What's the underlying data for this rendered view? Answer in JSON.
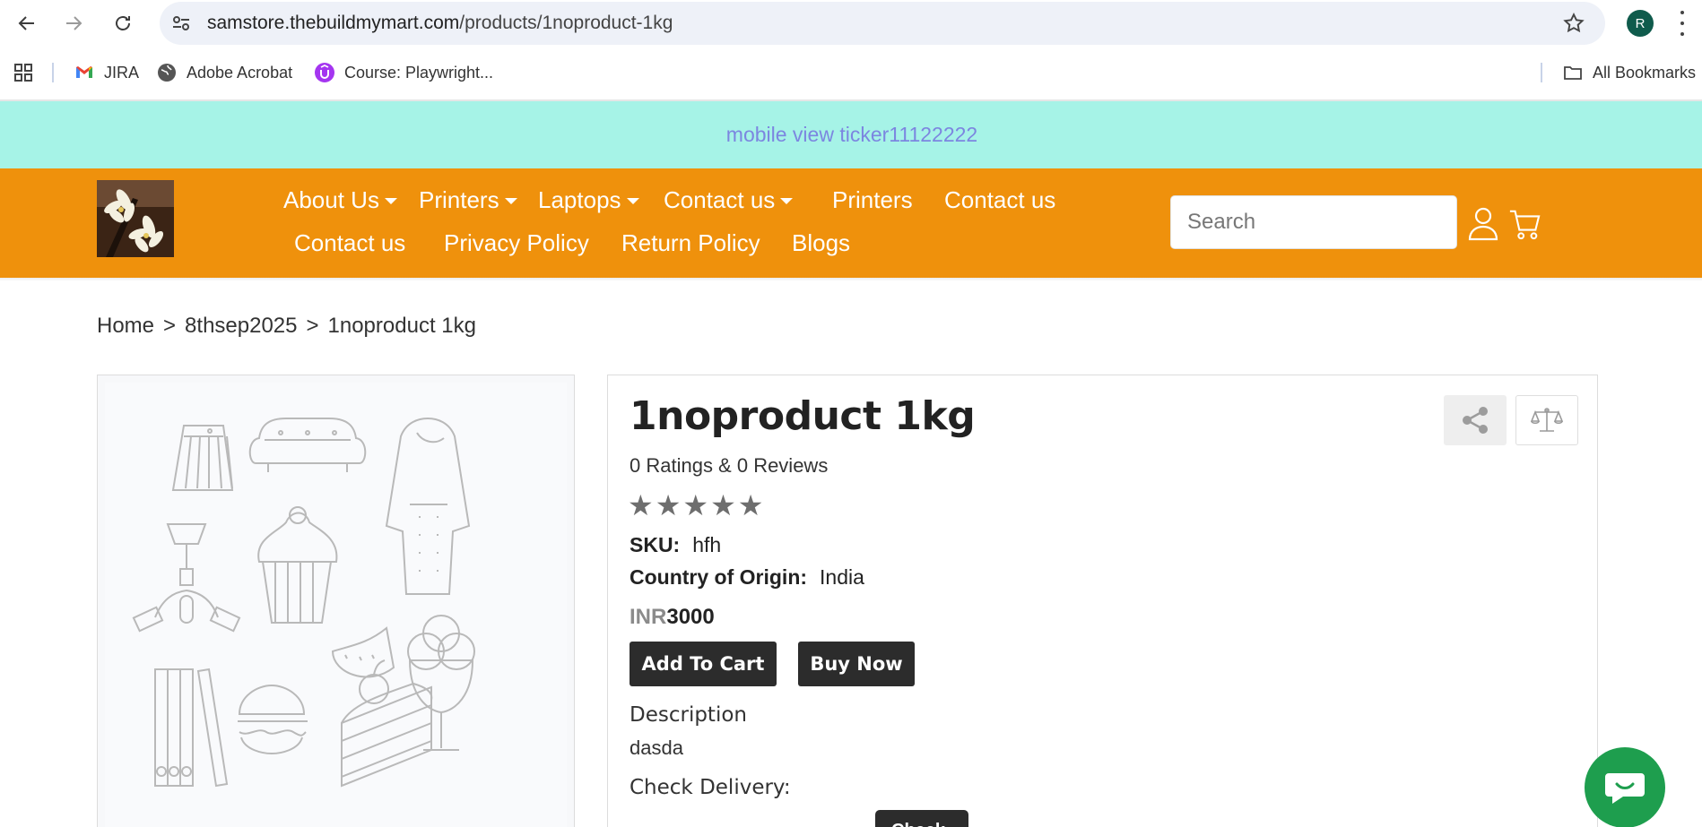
{
  "browser": {
    "url_host": "samstore.thebuildmymart.com",
    "url_path": "/products/1noproduct-1kg",
    "profile_initial": "R",
    "bookmarks": [
      {
        "label": "JIRA",
        "icon": "gmail-icon"
      },
      {
        "label": "Adobe Acrobat",
        "icon": "globe-icon"
      },
      {
        "label": "Course: Playwright...",
        "icon": "udemy-icon"
      }
    ],
    "all_bookmarks_label": "All Bookmarks"
  },
  "ticker": {
    "text": "mobile view ticker11122222"
  },
  "header": {
    "menu": [
      {
        "label": "About Us",
        "dropdown": true
      },
      {
        "label": "Printers",
        "dropdown": true
      },
      {
        "label": "Laptops",
        "dropdown": true
      },
      {
        "label": "Contact us",
        "dropdown": true
      },
      {
        "label": "Printers",
        "dropdown": false
      },
      {
        "label": "Contact us",
        "dropdown": false
      },
      {
        "label": "Contact us",
        "dropdown": false
      },
      {
        "label": "Privacy Policy",
        "dropdown": false
      },
      {
        "label": "Return Policy",
        "dropdown": false
      },
      {
        "label": "Blogs",
        "dropdown": false
      }
    ],
    "search_placeholder": "Search",
    "colors": {
      "header_bg": "#ef910c",
      "ticker_bg": "#a6f3e7",
      "ticker_text": "#7c86e0"
    }
  },
  "breadcrumb": {
    "items": [
      "Home",
      "8thsep2025",
      "1noproduct 1kg"
    ],
    "separator": ">"
  },
  "product": {
    "title": "1noproduct 1kg",
    "ratings_text": "0 Ratings & 0 Reviews",
    "stars": "★★★★★",
    "rating_value": 0,
    "sku_label": "SKU:",
    "sku_value": "hfh",
    "origin_label": "Country of Origin:",
    "origin_value": "India",
    "price_currency": "INR",
    "price_amount": "3000",
    "add_to_cart_label": "Add To Cart",
    "buy_now_label": "Buy Now",
    "description_label": "Description",
    "description_text": "dasda",
    "check_delivery_label": "Check Delivery:",
    "check_button_label": "Check"
  }
}
